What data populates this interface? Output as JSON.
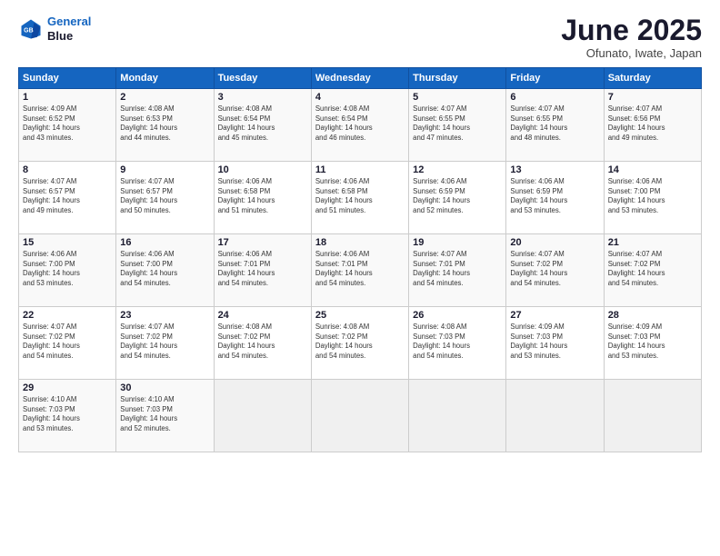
{
  "header": {
    "logo_line1": "General",
    "logo_line2": "Blue",
    "title": "June 2025",
    "location": "Ofunato, Iwate, Japan"
  },
  "days_of_week": [
    "Sunday",
    "Monday",
    "Tuesday",
    "Wednesday",
    "Thursday",
    "Friday",
    "Saturday"
  ],
  "weeks": [
    [
      {
        "day": "1",
        "info": "Sunrise: 4:09 AM\nSunset: 6:52 PM\nDaylight: 14 hours\nand 43 minutes."
      },
      {
        "day": "2",
        "info": "Sunrise: 4:08 AM\nSunset: 6:53 PM\nDaylight: 14 hours\nand 44 minutes."
      },
      {
        "day": "3",
        "info": "Sunrise: 4:08 AM\nSunset: 6:54 PM\nDaylight: 14 hours\nand 45 minutes."
      },
      {
        "day": "4",
        "info": "Sunrise: 4:08 AM\nSunset: 6:54 PM\nDaylight: 14 hours\nand 46 minutes."
      },
      {
        "day": "5",
        "info": "Sunrise: 4:07 AM\nSunset: 6:55 PM\nDaylight: 14 hours\nand 47 minutes."
      },
      {
        "day": "6",
        "info": "Sunrise: 4:07 AM\nSunset: 6:55 PM\nDaylight: 14 hours\nand 48 minutes."
      },
      {
        "day": "7",
        "info": "Sunrise: 4:07 AM\nSunset: 6:56 PM\nDaylight: 14 hours\nand 49 minutes."
      }
    ],
    [
      {
        "day": "8",
        "info": "Sunrise: 4:07 AM\nSunset: 6:57 PM\nDaylight: 14 hours\nand 49 minutes."
      },
      {
        "day": "9",
        "info": "Sunrise: 4:07 AM\nSunset: 6:57 PM\nDaylight: 14 hours\nand 50 minutes."
      },
      {
        "day": "10",
        "info": "Sunrise: 4:06 AM\nSunset: 6:58 PM\nDaylight: 14 hours\nand 51 minutes."
      },
      {
        "day": "11",
        "info": "Sunrise: 4:06 AM\nSunset: 6:58 PM\nDaylight: 14 hours\nand 51 minutes."
      },
      {
        "day": "12",
        "info": "Sunrise: 4:06 AM\nSunset: 6:59 PM\nDaylight: 14 hours\nand 52 minutes."
      },
      {
        "day": "13",
        "info": "Sunrise: 4:06 AM\nSunset: 6:59 PM\nDaylight: 14 hours\nand 53 minutes."
      },
      {
        "day": "14",
        "info": "Sunrise: 4:06 AM\nSunset: 7:00 PM\nDaylight: 14 hours\nand 53 minutes."
      }
    ],
    [
      {
        "day": "15",
        "info": "Sunrise: 4:06 AM\nSunset: 7:00 PM\nDaylight: 14 hours\nand 53 minutes."
      },
      {
        "day": "16",
        "info": "Sunrise: 4:06 AM\nSunset: 7:00 PM\nDaylight: 14 hours\nand 54 minutes."
      },
      {
        "day": "17",
        "info": "Sunrise: 4:06 AM\nSunset: 7:01 PM\nDaylight: 14 hours\nand 54 minutes."
      },
      {
        "day": "18",
        "info": "Sunrise: 4:06 AM\nSunset: 7:01 PM\nDaylight: 14 hours\nand 54 minutes."
      },
      {
        "day": "19",
        "info": "Sunrise: 4:07 AM\nSunset: 7:01 PM\nDaylight: 14 hours\nand 54 minutes."
      },
      {
        "day": "20",
        "info": "Sunrise: 4:07 AM\nSunset: 7:02 PM\nDaylight: 14 hours\nand 54 minutes."
      },
      {
        "day": "21",
        "info": "Sunrise: 4:07 AM\nSunset: 7:02 PM\nDaylight: 14 hours\nand 54 minutes."
      }
    ],
    [
      {
        "day": "22",
        "info": "Sunrise: 4:07 AM\nSunset: 7:02 PM\nDaylight: 14 hours\nand 54 minutes."
      },
      {
        "day": "23",
        "info": "Sunrise: 4:07 AM\nSunset: 7:02 PM\nDaylight: 14 hours\nand 54 minutes."
      },
      {
        "day": "24",
        "info": "Sunrise: 4:08 AM\nSunset: 7:02 PM\nDaylight: 14 hours\nand 54 minutes."
      },
      {
        "day": "25",
        "info": "Sunrise: 4:08 AM\nSunset: 7:02 PM\nDaylight: 14 hours\nand 54 minutes."
      },
      {
        "day": "26",
        "info": "Sunrise: 4:08 AM\nSunset: 7:03 PM\nDaylight: 14 hours\nand 54 minutes."
      },
      {
        "day": "27",
        "info": "Sunrise: 4:09 AM\nSunset: 7:03 PM\nDaylight: 14 hours\nand 53 minutes."
      },
      {
        "day": "28",
        "info": "Sunrise: 4:09 AM\nSunset: 7:03 PM\nDaylight: 14 hours\nand 53 minutes."
      }
    ],
    [
      {
        "day": "29",
        "info": "Sunrise: 4:10 AM\nSunset: 7:03 PM\nDaylight: 14 hours\nand 53 minutes."
      },
      {
        "day": "30",
        "info": "Sunrise: 4:10 AM\nSunset: 7:03 PM\nDaylight: 14 hours\nand 52 minutes."
      },
      {
        "day": "",
        "info": ""
      },
      {
        "day": "",
        "info": ""
      },
      {
        "day": "",
        "info": ""
      },
      {
        "day": "",
        "info": ""
      },
      {
        "day": "",
        "info": ""
      }
    ]
  ]
}
